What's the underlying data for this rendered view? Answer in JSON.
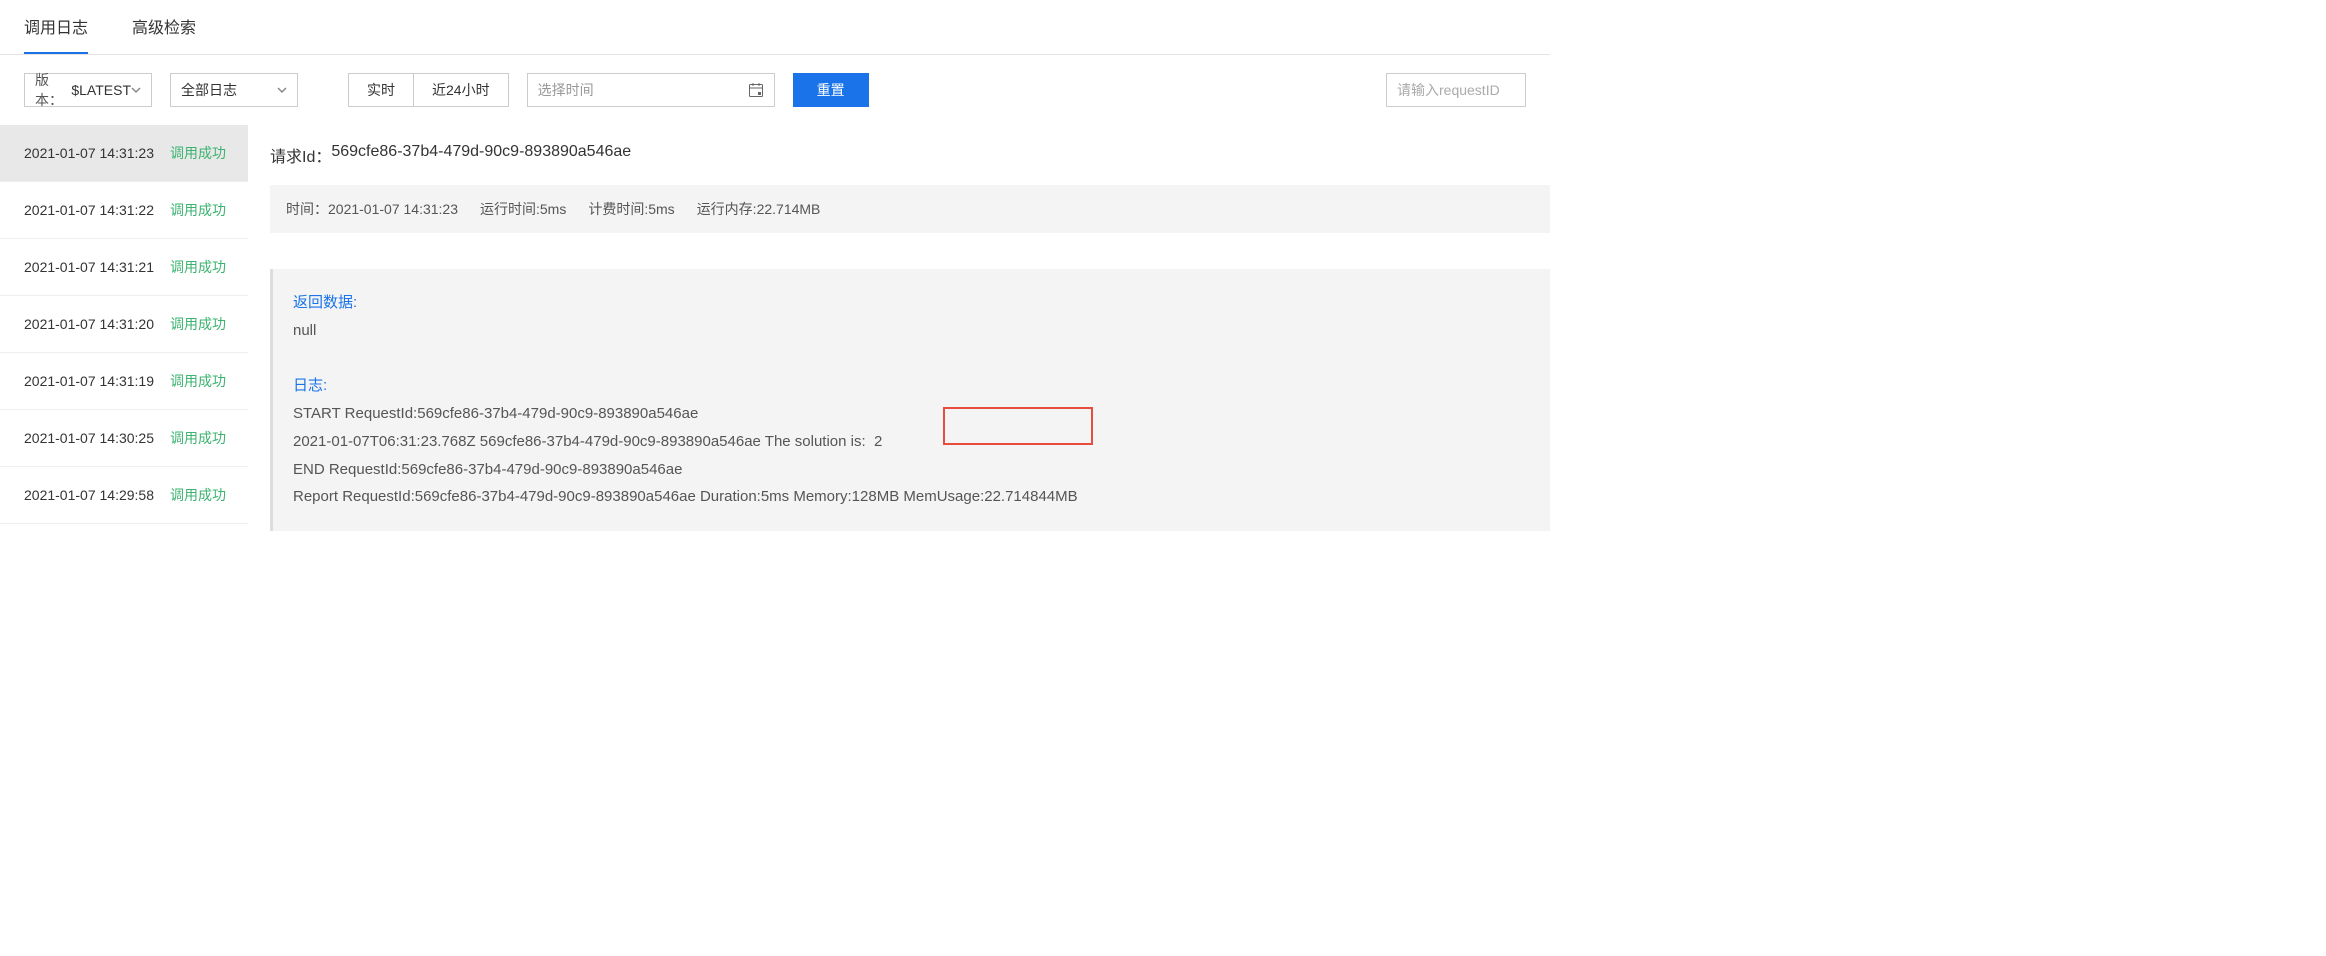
{
  "tabs": {
    "items": [
      {
        "label": "调用日志",
        "active": true
      },
      {
        "label": "高级检索",
        "active": false
      }
    ]
  },
  "filters": {
    "version_label": "版本：",
    "version_value": "$LATEST",
    "logtype_value": "全部日志",
    "seg_realtime": "实时",
    "seg_24h": "近24小时",
    "date_placeholder": "选择时间",
    "reset_label": "重置",
    "search_placeholder": "请输入requestID"
  },
  "log_list": {
    "items": [
      {
        "time": "2021-01-07 14:31:23",
        "status": "调用成功",
        "active": true
      },
      {
        "time": "2021-01-07 14:31:22",
        "status": "调用成功",
        "active": false
      },
      {
        "time": "2021-01-07 14:31:21",
        "status": "调用成功",
        "active": false
      },
      {
        "time": "2021-01-07 14:31:20",
        "status": "调用成功",
        "active": false
      },
      {
        "time": "2021-01-07 14:31:19",
        "status": "调用成功",
        "active": false
      },
      {
        "time": "2021-01-07 14:30:25",
        "status": "调用成功",
        "active": false
      },
      {
        "time": "2021-01-07 14:29:58",
        "status": "调用成功",
        "active": false
      }
    ]
  },
  "detail": {
    "request_id_label": "请求Id：",
    "request_id_value": "569cfe86-37b4-479d-90c9-893890a546ae",
    "stats": {
      "time_label": "时间：",
      "time_value": "2021-01-07 14:31:23",
      "runtime_label": "运行时间:",
      "runtime_value": "5ms",
      "billed_label": "计费时间:",
      "billed_value": "5ms",
      "memory_label": "运行内存:",
      "memory_value": "22.714MB"
    },
    "return_data_label": "返回数据:",
    "return_data_value": "null",
    "log_label": "日志:",
    "log_lines": [
      "START RequestId:569cfe86-37b4-479d-90c9-893890a546ae",
      "2021-01-07T06:31:23.768Z 569cfe86-37b4-479d-90c9-893890a546ae The solution is:  2",
      "END RequestId:569cfe86-37b4-479d-90c9-893890a546ae",
      "Report RequestId:569cfe86-37b4-479d-90c9-893890a546ae Duration:5ms Memory:128MB MemUsage:22.714844MB"
    ]
  }
}
